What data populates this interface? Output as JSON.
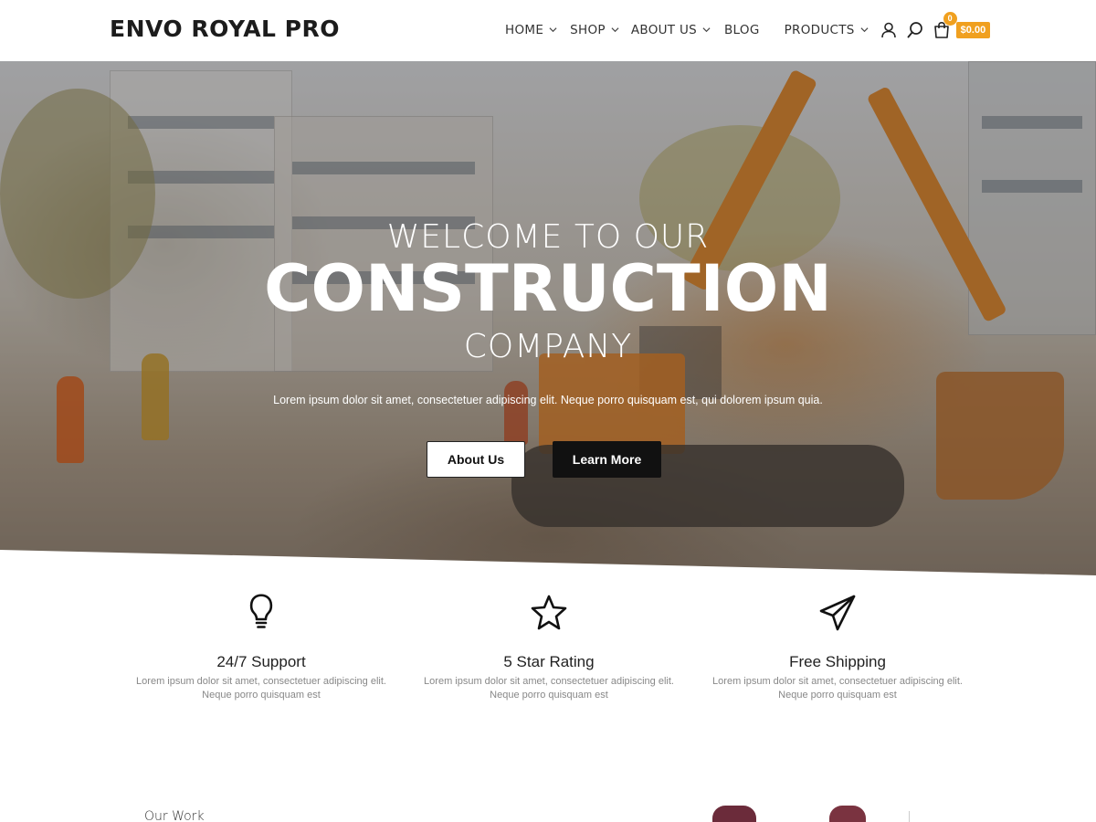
{
  "header": {
    "logo": "ENVO ROYAL PRO",
    "nav": [
      {
        "label": "HOME",
        "has_dropdown": true
      },
      {
        "label": "SHOP",
        "has_dropdown": true
      },
      {
        "label": "ABOUT US",
        "has_dropdown": true
      },
      {
        "label": "BLOG",
        "has_dropdown": false
      },
      {
        "label": "PRODUCTS",
        "has_dropdown": true
      }
    ],
    "icons": [
      "user-icon",
      "search-icon",
      "cart-icon"
    ],
    "cart_count": "0",
    "cart_total": "$0.00"
  },
  "hero": {
    "line1": "WELCOME TO OUR",
    "line2": "CONSTRUCTION",
    "line3": "COMPANY",
    "subtitle": "Lorem ipsum dolor sit amet, consectetuer adipiscing elit. Neque porro quisquam est, qui dolorem ipsum quia.",
    "buttons": {
      "about": "About Us",
      "learn": "Learn More"
    }
  },
  "features": [
    {
      "icon": "lightbulb-icon",
      "title": "24/7 Support",
      "desc_line1": "Lorem ipsum dolor sit amet, consectetuer adipiscing elit.",
      "desc_line2": "Neque porro quisquam est"
    },
    {
      "icon": "star-icon",
      "title": "5 Star Rating",
      "desc_line1": "Lorem ipsum dolor sit amet, consectetuer adipiscing elit.",
      "desc_line2": "Neque porro quisquam est"
    },
    {
      "icon": "paper-plane-icon",
      "title": "Free Shipping",
      "desc_line1": "Lorem ipsum dolor sit amet, consectetuer adipiscing elit.",
      "desc_line2": "Neque porro quisquam est"
    }
  ],
  "section_next": {
    "title": "Our Work"
  },
  "colors": {
    "accent": "#f0a01f",
    "dark": "#111111",
    "text": "#222222",
    "muted": "#888888"
  }
}
